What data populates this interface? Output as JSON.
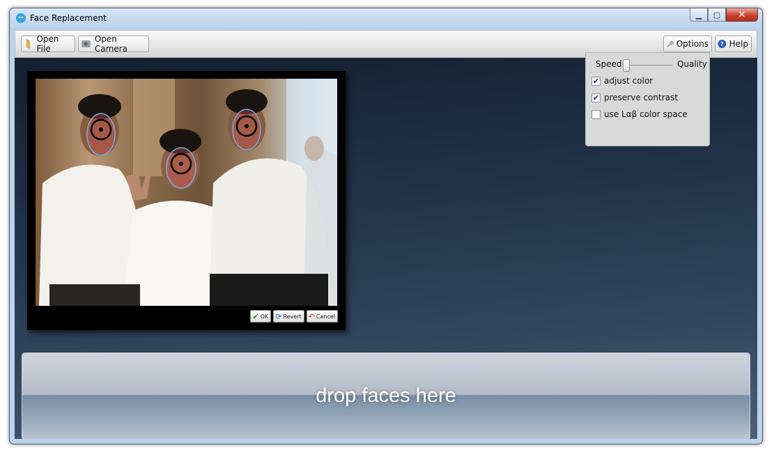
{
  "window": {
    "title": "Face Replacement"
  },
  "toolbar": {
    "open_file": "Open File",
    "open_camera": "Open Camera",
    "options": "Options",
    "help": "Help"
  },
  "photo_actions": {
    "ok": "OK",
    "revert": "Revert",
    "cancel": "Cancel"
  },
  "options": {
    "speed_label": "Speed",
    "quality_label": "Quality",
    "slider_position": 0.05,
    "adjust_color": {
      "label": "adjust color",
      "checked": true
    },
    "preserve_contrast": {
      "label": "preserve contrast",
      "checked": true
    },
    "use_lab": {
      "label": "use Lαβ color space",
      "checked": false
    }
  },
  "dropzone": {
    "text": "drop faces here"
  },
  "colors": {
    "accent": "#2d6fd1",
    "close": "#c9432e",
    "face_marker": "#6fb1e6"
  }
}
